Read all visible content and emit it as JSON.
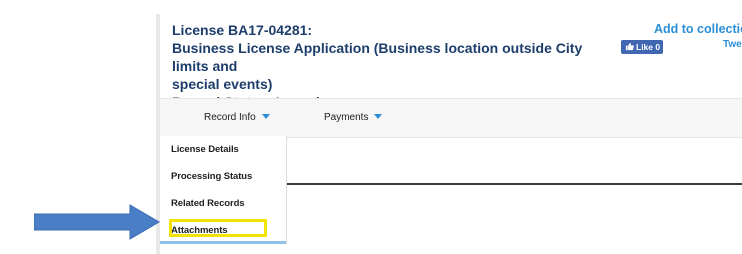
{
  "header": {
    "license_line": "License BA17-04281:",
    "application_line_1": "Business License Application (Business location outside City limits and",
    "application_line_2": "special events)",
    "status_line": "Record Status: Issued",
    "add_to_collection": "Add to collection",
    "like_label": "Like 0",
    "tweet_label": "Tweet"
  },
  "tabs": [
    {
      "label": "Record Info"
    },
    {
      "label": "Payments"
    }
  ],
  "dropdown": {
    "items": [
      {
        "label": "License Details"
      },
      {
        "label": "Processing Status"
      },
      {
        "label": "Related Records"
      },
      {
        "label": "Attachments",
        "highlighted": true
      }
    ]
  },
  "colors": {
    "title": "#1d3d6b",
    "link": "#2b8fd6",
    "highlight": "#f2e400",
    "arrow": "#4a7fc8"
  },
  "icons": {
    "like": "thumbs-up-icon",
    "caret": "caret-down-icon",
    "pointer": "right-arrow-icon"
  }
}
